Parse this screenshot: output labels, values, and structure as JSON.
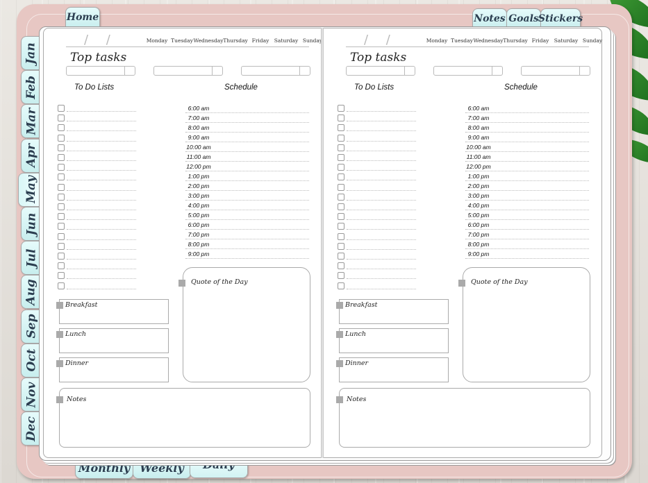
{
  "top_tabs": {
    "home": "Home",
    "notes": "Notes",
    "goals": "Goals",
    "stickers": "Stickers"
  },
  "bottom_tabs": [
    {
      "label": "Monthly",
      "active": false
    },
    {
      "label": "Weekly",
      "active": false
    },
    {
      "label": "Daily",
      "active": true
    }
  ],
  "months": [
    {
      "label": "Jan",
      "active": false
    },
    {
      "label": "Feb",
      "active": false
    },
    {
      "label": "Mar",
      "active": false
    },
    {
      "label": "Apr",
      "active": false
    },
    {
      "label": "May",
      "active": true
    },
    {
      "label": "Jun",
      "active": false
    },
    {
      "label": "Jul",
      "active": false
    },
    {
      "label": "Aug",
      "active": false
    },
    {
      "label": "Sep",
      "active": false
    },
    {
      "label": "Oct",
      "active": false
    },
    {
      "label": "Nov",
      "active": false
    },
    {
      "label": "Dec",
      "active": false
    }
  ],
  "days": [
    "Monday",
    "Tuesday",
    "Wednesday",
    "Thursday",
    "Friday",
    "Saturday",
    "Sunday"
  ],
  "page": {
    "date_slashes": "/ /",
    "top_tasks_title": "Top tasks",
    "todo_title": "To Do Lists",
    "schedule_title": "Schedule",
    "quote_label": "Quote of the Day",
    "meals": [
      "Breakfast",
      "Lunch",
      "Dinner"
    ],
    "notes_label": "Notes",
    "times": [
      "6:00 am",
      "7:00 am",
      "8:00 am",
      "9:00 am",
      "10:00 am",
      "11:00 am",
      "12:00 pm",
      "1:00 pm",
      "2:00 pm",
      "3:00 pm",
      "4:00 pm",
      "5:00 pm",
      "6:00 pm",
      "7:00 pm",
      "8:00 pm",
      "9:00 pm"
    ]
  },
  "colors": {
    "cover": "#e7c7c3",
    "tab": "#c8eeee",
    "page": "#ffffff"
  }
}
